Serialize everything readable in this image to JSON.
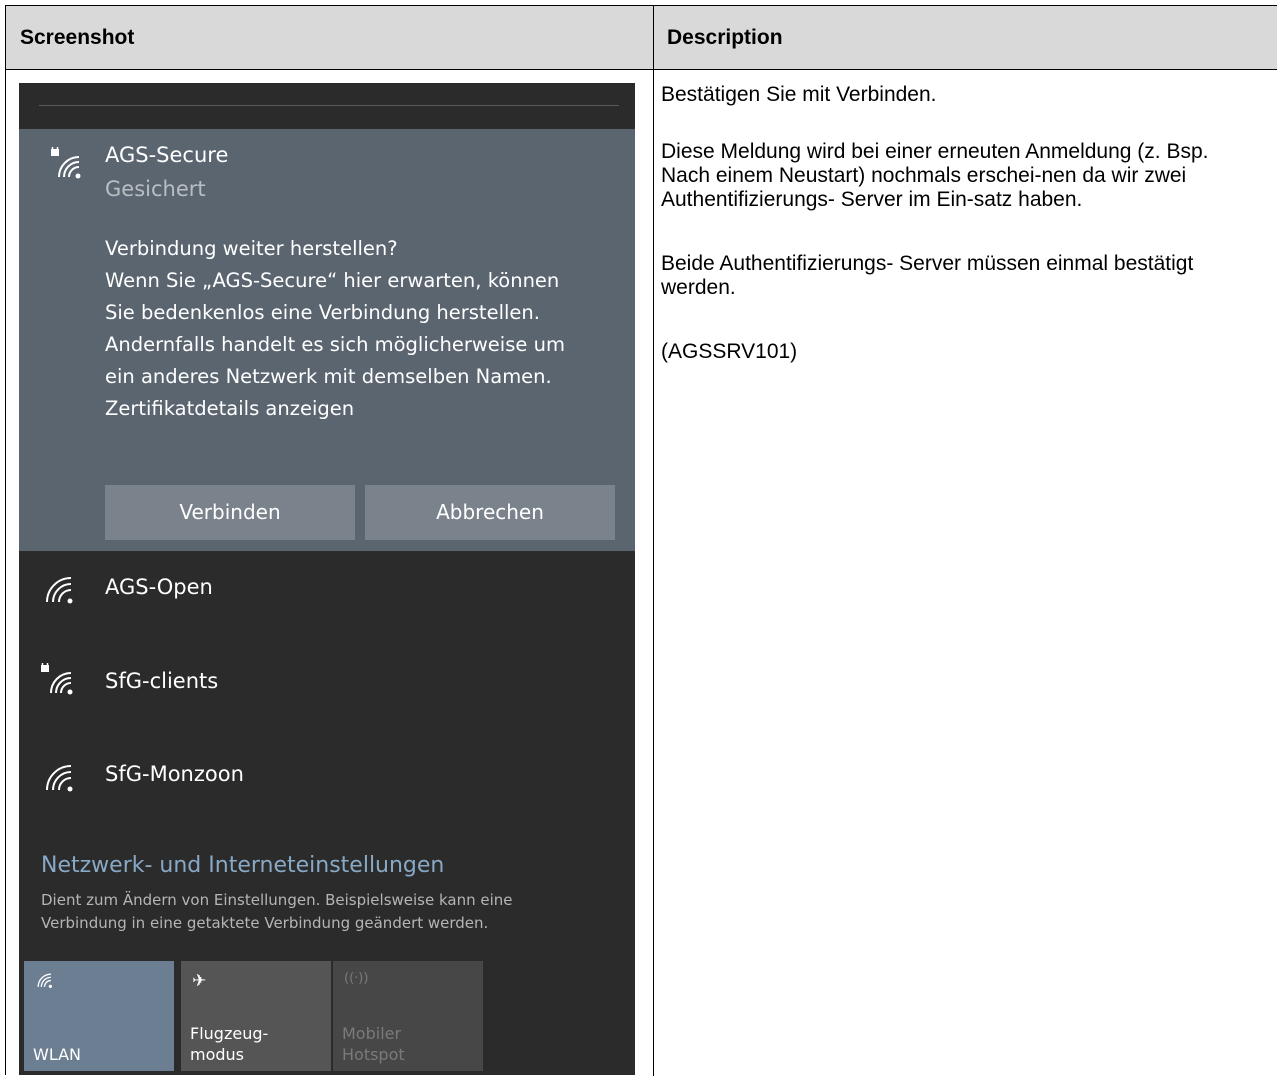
{
  "table": {
    "header_screenshot": "Screenshot",
    "header_description": "Description"
  },
  "description": {
    "p1": "Bestätigen Sie mit Verbinden.",
    "p2": "Diese Meldung wird bei einer erneuten Anmeldung (z. Bsp. Nach einem Neustart) nochmals erschei-nen da wir zwei Authentifizierungs- Server im Ein-satz haben.",
    "p3": "Beide Authentifizierungs- Server müssen einmal bestätigt werden.",
    "p4": "(AGSSRV101)"
  },
  "flyout": {
    "selected_network": {
      "name": "AGS-Secure",
      "status": "Gesichert",
      "icon": "wifi-secured-icon",
      "prompt_lines": [
        "Verbindung weiter herstellen?",
        "Wenn Sie „AGS-Secure“ hier erwarten, können",
        "Sie bedenkenlos eine Verbindung herstellen.",
        "Andernfalls handelt es sich möglicherweise um",
        "ein anderes Netzwerk mit demselben Namen.",
        "Zertifikatdetails anzeigen"
      ],
      "connect_label": "Verbinden",
      "cancel_label": "Abbrechen"
    },
    "networks": [
      {
        "name": "AGS-Open",
        "icon": "wifi-icon",
        "secured": false
      },
      {
        "name": "SfG-clients",
        "icon": "wifi-secured-icon",
        "secured": true
      },
      {
        "name": "SfG-Monzoon",
        "icon": "wifi-icon",
        "secured": false
      }
    ],
    "settings": {
      "link": "Netzwerk- und Interneteinstellungen",
      "desc_lines": [
        "Dient zum Ändern von Einstellungen. Beispielsweise kann eine",
        "Verbindung in eine getaktete Verbindung geändert werden."
      ]
    },
    "tiles": {
      "wlan": {
        "label": "WLAN",
        "icon": "wifi-icon",
        "active": true
      },
      "flight_line1": "Flugzeug-",
      "flight_line2": "modus",
      "flight_icon": "airplane-icon",
      "hotspot_line1": "Mobiler",
      "hotspot_line2": "Hotspot",
      "hotspot_icon": "hotspot-icon"
    },
    "colors": {
      "background": "#2b2b2b",
      "selected": "#5a6570",
      "button": "#7a838c",
      "link": "#88a9c6",
      "wlan_tile": "#6b7e92"
    }
  }
}
